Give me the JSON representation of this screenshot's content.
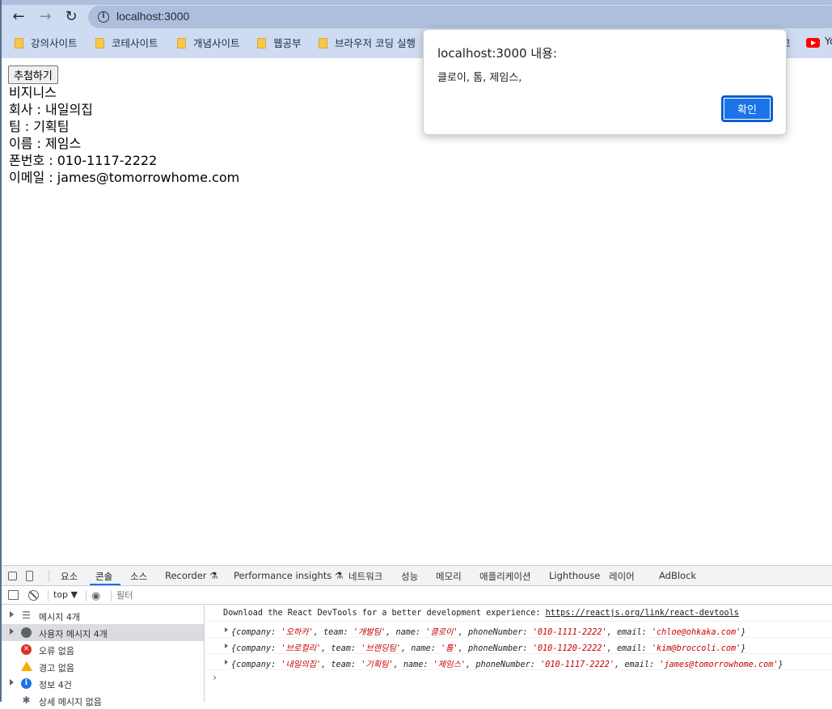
{
  "browser": {
    "url": "localhost:3000",
    "bookmarks": [
      "강의사이트",
      "코테사이트",
      "개념사이트",
      "웹공부",
      "브라우저 코딩 실행"
    ],
    "bookmark_right_fragment": "고",
    "youtube_fragment": "Yo"
  },
  "page": {
    "button_label": "추첨하기",
    "category": "비지니스",
    "company": "회사 : 내일의집",
    "team": "팀 : 기획팀",
    "name": "이름 : 제임스",
    "phone": "폰번호 : 010-1117-2222",
    "email": "이메일 : james@tomorrowhome.com"
  },
  "alert": {
    "title": "localhost:3000 내용:",
    "message": "클로이, 톰, 제임스,",
    "ok_label": "확인"
  },
  "devtools": {
    "tabs": [
      "요소",
      "콘솔",
      "소스",
      "Recorder ⚗",
      "Performance insights ⚗",
      "네트워크",
      "성능",
      "메모리",
      "애플리케이션",
      "Lighthouse",
      "레이어",
      "AdBlock"
    ],
    "active_tab": "콘솔",
    "context": "top ▼",
    "filter_placeholder": "필터",
    "sidebar": [
      {
        "label": "메시지 4개",
        "icon": "list-icon"
      },
      {
        "label": "사용자 메시지 4개",
        "icon": "user-icon"
      },
      {
        "label": "오류 없음",
        "icon": "error-icon"
      },
      {
        "label": "경고 없음",
        "icon": "warning-icon"
      },
      {
        "label": "정보 4건",
        "icon": "info-icon"
      },
      {
        "label": "상세 메시지 없음",
        "icon": "verbose-icon"
      }
    ],
    "console": {
      "devtools_notice": "Download the React DevTools for a better development experience: ",
      "devtools_link": "https://reactjs.org/link/react-devtools",
      "logs": [
        {
          "company": "'오하카'",
          "team": "'개발팀'",
          "name": "'클로이'",
          "phoneNumber": "'010-1111-2222'",
          "email": "'chloe@ohkaka.com'"
        },
        {
          "company": "'브로컬리'",
          "team": "'브랜딩팀'",
          "name": "'톰'",
          "phoneNumber": "'010-1120-2222'",
          "email": "'kim@broccoli.com'"
        },
        {
          "company": "'내일의집'",
          "team": "'기획팀'",
          "name": "'제임스'",
          "phoneNumber": "'010-1117-2222'",
          "email": "'james@tomorrowhome.com'"
        }
      ]
    }
  }
}
